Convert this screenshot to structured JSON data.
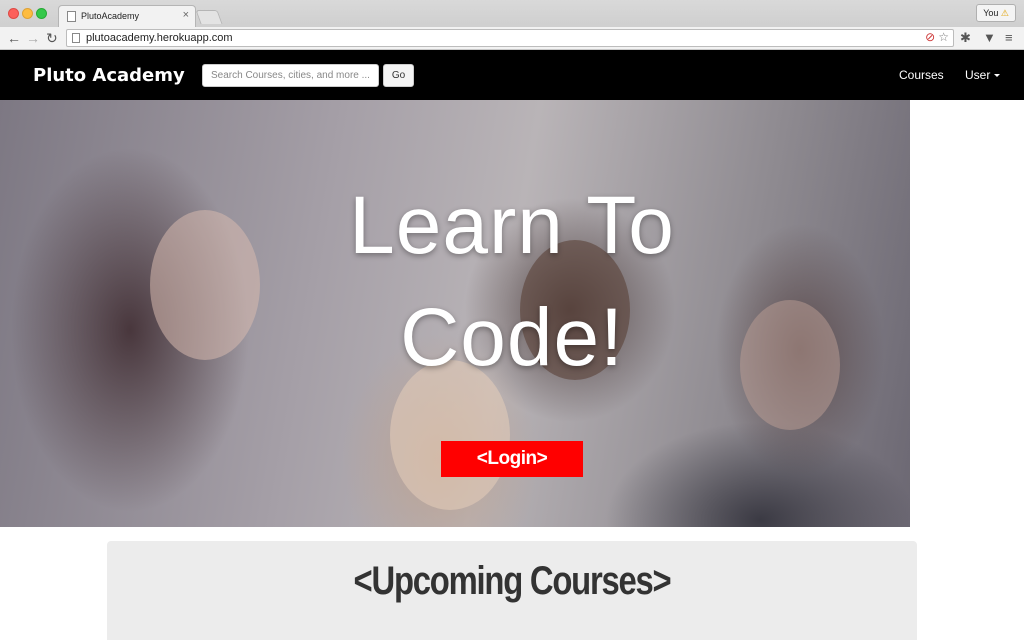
{
  "browser": {
    "tab_title": "PlutoAcademy",
    "tab_close": "×",
    "profile_label": "You",
    "profile_warning": "⚠",
    "url": "plutoacademy.herokuapp.com",
    "icons": [
      "back-icon",
      "forward-icon",
      "reload-icon",
      "page-icon",
      "blocked-icon",
      "star-icon",
      "puzzle-icon",
      "pocket-icon",
      "menu-icon"
    ]
  },
  "navbar": {
    "brand": "Pluto Academy",
    "search_placeholder": "Search Courses, cities, and more ...",
    "go_label": "Go",
    "links": {
      "courses": "Courses",
      "user": "User"
    }
  },
  "hero": {
    "title_line1": "Learn To",
    "title_line2": "Code!",
    "login_label": "<Login>"
  },
  "courses": {
    "heading": "<Upcoming Courses>"
  },
  "colors": {
    "navbar_bg": "#000000",
    "login_bg": "#ff0000",
    "panel_bg": "#ececec"
  }
}
